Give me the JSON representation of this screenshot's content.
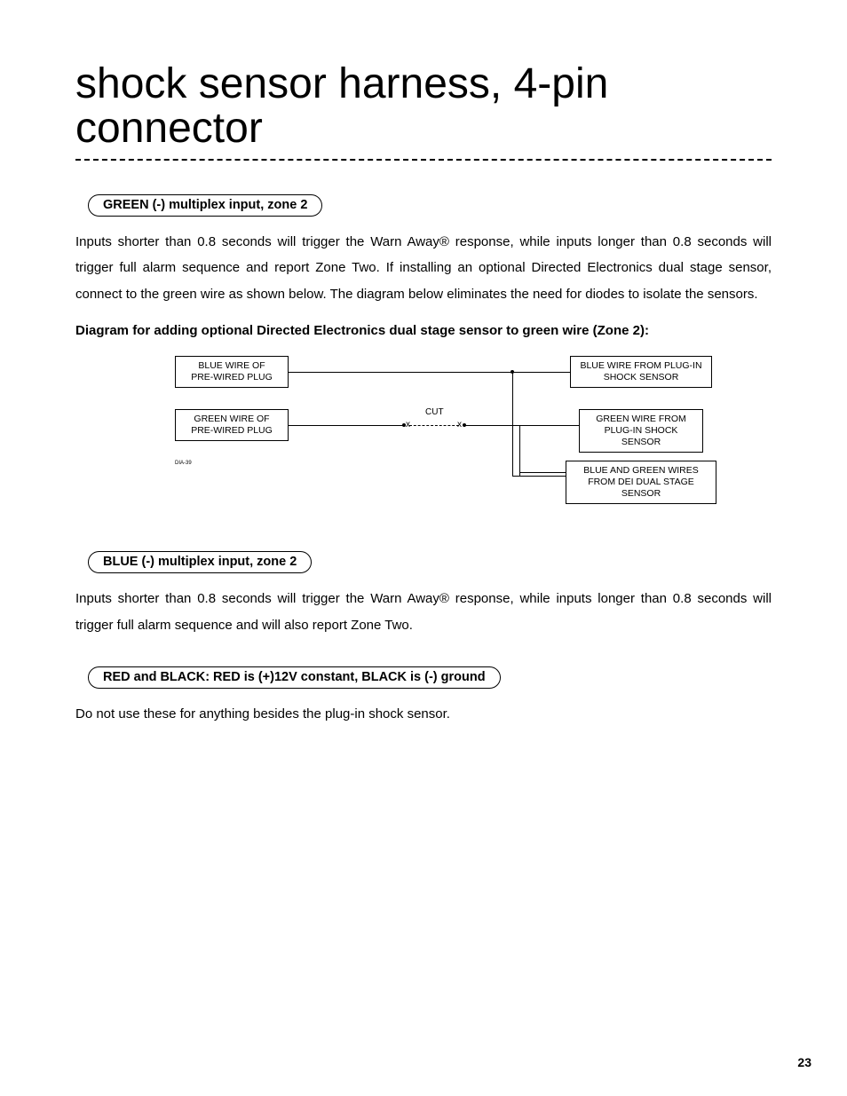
{
  "title": "shock sensor harness, 4-pin connector",
  "sections": {
    "green": {
      "pill": "GREEN (-) multiplex input, zone 2",
      "body": "Inputs shorter than 0.8 seconds will trigger the Warn Away® response, while inputs longer than 0.8 seconds will trigger full alarm sequence and report Zone Two. If installing an optional Directed Electronics dual stage sensor, connect to the green wire as shown below. The diagram below eliminates the need for diodes to isolate the sensors.",
      "caption": "Diagram for adding optional Directed Electronics dual stage sensor to green wire (Zone 2):"
    },
    "blue": {
      "pill": "BLUE (-) multiplex input, zone 2",
      "body": "Inputs shorter than 0.8 seconds will trigger the Warn Away® response, while inputs longer than 0.8 seconds will trigger full alarm sequence and will also report Zone Two."
    },
    "redblack": {
      "pill": "RED and BLACK: RED is (+)12V constant, BLACK is (-) ground",
      "body": "Do not use these for anything besides the plug-in shock sensor."
    }
  },
  "diagram": {
    "left_top": "BLUE WIRE OF\nPRE-WIRED PLUG",
    "left_bottom": "GREEN WIRE OF\nPRE-WIRED PLUG",
    "right_top": "BLUE WIRE FROM PLUG-IN\nSHOCK SENSOR",
    "right_mid": "GREEN WIRE FROM\nPLUG-IN SHOCK SENSOR",
    "right_bot": "BLUE AND GREEN WIRES\nFROM DEI DUAL STAGE SENSOR",
    "cut_label": "CUT",
    "tag": "DIA-39"
  },
  "page_number": "23"
}
